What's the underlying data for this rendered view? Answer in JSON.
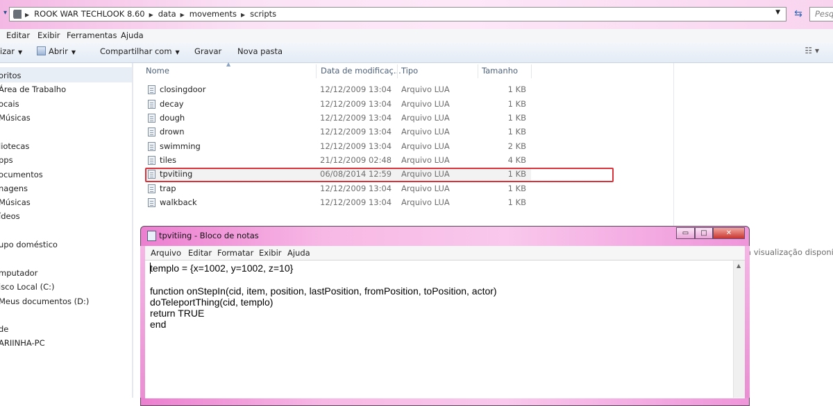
{
  "explorer": {
    "address": {
      "crumbs": [
        "ROOK WAR TECHLOOK 8.60",
        "data",
        "movements",
        "scripts"
      ]
    },
    "search_placeholder": "Pesquisar",
    "menu": [
      "Editar",
      "Exibir",
      "Ferramentas",
      "Ajuda"
    ],
    "toolbar": {
      "organize": "izar",
      "open": "Abrir",
      "share": "Compartilhar com",
      "record": "Gravar",
      "new_folder": "Nova pasta"
    },
    "nav": [
      "oritos",
      "Área de Trabalho",
      "ocais",
      "Músicas",
      "liotecas",
      "pps",
      "ocumentos",
      "nagens",
      "Músicas",
      "ídeos",
      "upo doméstico",
      "mputador",
      "isco Local (C:)",
      "Meus documentos (D:)",
      "de",
      "ARIINHA-PC"
    ],
    "columns": {
      "name": "Nome",
      "date": "Data de modificaç...",
      "type": "Tipo",
      "size": "Tamanho"
    },
    "files": [
      {
        "name": "closingdoor",
        "date": "12/12/2009 13:04",
        "type": "Arquivo LUA",
        "size": "1 KB"
      },
      {
        "name": "decay",
        "date": "12/12/2009 13:04",
        "type": "Arquivo LUA",
        "size": "1 KB"
      },
      {
        "name": "dough",
        "date": "12/12/2009 13:04",
        "type": "Arquivo LUA",
        "size": "1 KB"
      },
      {
        "name": "drown",
        "date": "12/12/2009 13:04",
        "type": "Arquivo LUA",
        "size": "1 KB"
      },
      {
        "name": "swimming",
        "date": "12/12/2009 13:04",
        "type": "Arquivo LUA",
        "size": "2 KB"
      },
      {
        "name": "tiles",
        "date": "21/12/2009 02:48",
        "type": "Arquivo LUA",
        "size": "4 KB"
      },
      {
        "name": "tpvitiing",
        "date": "06/08/2014 12:59",
        "type": "Arquivo LUA",
        "size": "1 KB"
      },
      {
        "name": "trap",
        "date": "12/12/2009 13:04",
        "type": "Arquivo LUA",
        "size": "1 KB"
      },
      {
        "name": "walkback",
        "date": "12/12/2009 13:04",
        "type": "Arquivo LUA",
        "size": "1 KB"
      }
    ],
    "preview_text": "a visualização disponível"
  },
  "notepad": {
    "title": "tpvitiing - Bloco de notas",
    "menu": [
      "Arquivo",
      "Editar",
      "Formatar",
      "Exibir",
      "Ajuda"
    ],
    "content": "templo = {x=1002, y=1002, z=10}\n\nfunction onStepIn(cid, item, position, lastPosition, fromPosition, toPosition, actor)\ndoTeleportThing(cid, templo)\nreturn TRUE\nend"
  },
  "colors": {
    "highlight_border": "#d9323a",
    "window_frame": "#f7b8e5"
  }
}
